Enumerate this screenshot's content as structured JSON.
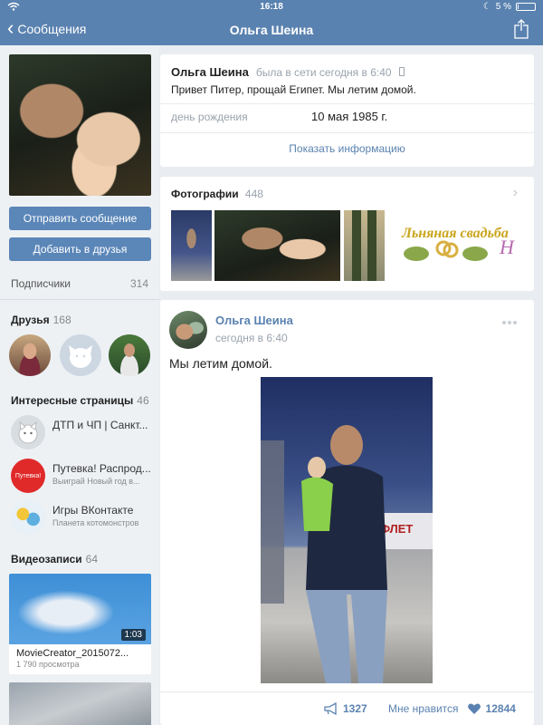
{
  "status": {
    "time": "16:18",
    "battery": "5 %",
    "battery_level": 0.05
  },
  "nav": {
    "back_label": "Сообщения",
    "title": "Ольга Шеина"
  },
  "left": {
    "send_message": "Отправить сообщение",
    "add_friend": "Добавить в друзья",
    "followers_label": "Подписчики",
    "followers_count": "314",
    "friends_label": "Друзья",
    "friends_count": "168",
    "pages_label": "Интересные страницы",
    "pages_count": "46",
    "pages": [
      {
        "name": "ДТП и ЧП | Санкт...",
        "sub": ""
      },
      {
        "name": "Путевка! Распрод...",
        "sub": "Выиграй Новый год в..."
      },
      {
        "name": "Игры ВКонтакте",
        "sub": "Планета котомонстров"
      }
    ],
    "videos_label": "Видеозаписи",
    "videos_count": "64",
    "video": {
      "duration": "1:03",
      "title": "MovieCreator_2015072...",
      "views": "1 790 просмотра"
    }
  },
  "profile": {
    "name": "Ольга Шеина",
    "last_seen": "была в сети сегодня в 6:40",
    "status_text": "Привет Питер,  прощай Египет.  Мы летим домой.",
    "birthday_label": "день рождения",
    "birthday_value": "10 мая 1985 г.",
    "show_info": "Показать информацию"
  },
  "photos": {
    "label": "Фотографии",
    "count": "448",
    "banner_text": "Льняная свадьба",
    "banner_tail": "Н"
  },
  "post": {
    "author": "Ольга Шеина",
    "time": "сегодня в 6:40",
    "text": "Мы летим домой.",
    "plane_text": "ФЛЕТ",
    "reposts": "1327",
    "like_label": "Мне нравится",
    "likes": "12844"
  }
}
